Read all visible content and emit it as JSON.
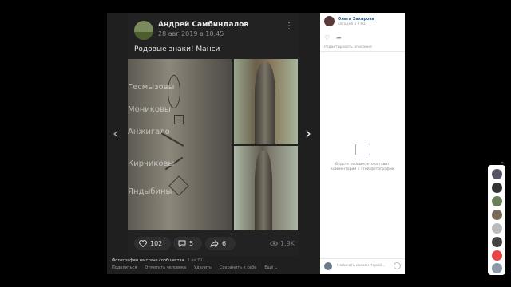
{
  "post": {
    "author": "Андрей Самбиндалов",
    "date": "28 авг 2019 в 10:45",
    "text": "Родовые знаки! Манси",
    "overlay_words": [
      "Гесмызовы",
      "Мониковы",
      "Анжигало",
      "Кирчиковы",
      "Яндыбины"
    ],
    "likes": "102",
    "comments": "5",
    "shares": "6",
    "views": "1,9K"
  },
  "icons": {
    "like": "heart-icon",
    "comment": "comment-icon",
    "share": "share-icon",
    "views": "eye-icon",
    "more": "more-vertical-icon"
  },
  "nav": {
    "prev": "‹",
    "next": "›"
  },
  "footer": {
    "album": "Фотографии на стене сообщества",
    "counter": "1 из 70",
    "links": [
      "Поделиться",
      "Отметить человека",
      "Удалить",
      "Сохранить к себе",
      "Ещё ⌄"
    ]
  },
  "panel": {
    "name": "Ольга Захарова",
    "time": "сегодня в 2:03",
    "edit": "Редактировать описание",
    "empty": "Будьте первым, кто оставит комментарий к этой фотографии",
    "comment_placeholder": "Написать комментарий..."
  },
  "colors": {
    "link": "#2a5885",
    "accent": "#e64646"
  }
}
